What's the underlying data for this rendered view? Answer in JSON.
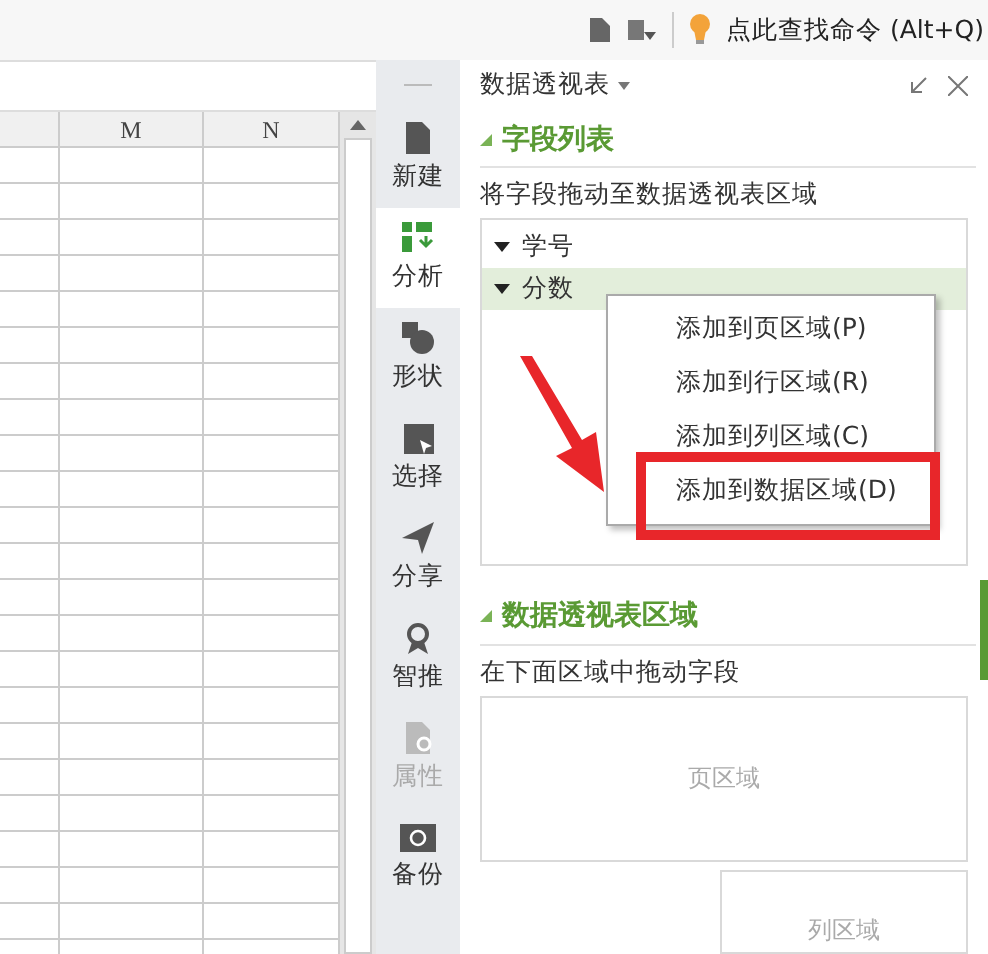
{
  "top_bar": {
    "search_hint": "点此查找命令 (Alt+Q)"
  },
  "spreadsheet": {
    "columns": [
      "M",
      "N"
    ]
  },
  "sidebar": {
    "items": [
      {
        "label": "新建",
        "selected": false,
        "disabled": false
      },
      {
        "label": "分析",
        "selected": true,
        "disabled": false
      },
      {
        "label": "形状",
        "selected": false,
        "disabled": false
      },
      {
        "label": "选择",
        "selected": false,
        "disabled": false
      },
      {
        "label": "分享",
        "selected": false,
        "disabled": false
      },
      {
        "label": "智推",
        "selected": false,
        "disabled": false
      },
      {
        "label": "属性",
        "selected": false,
        "disabled": true
      },
      {
        "label": "备份",
        "selected": false,
        "disabled": false
      }
    ]
  },
  "panel": {
    "title": "数据透视表",
    "field_section": {
      "heading": "字段列表",
      "hint": "将字段拖动至数据透视表区域",
      "fields": [
        {
          "label": "学号",
          "selected": false
        },
        {
          "label": "分数",
          "selected": true
        }
      ]
    },
    "context_menu": {
      "items": [
        {
          "label": "添加到页区域(P)",
          "marked": false
        },
        {
          "label": "添加到行区域(R)",
          "marked": false
        },
        {
          "label": "添加到列区域(C)",
          "marked": false
        },
        {
          "label": "添加到数据区域(D)",
          "marked": true
        }
      ]
    },
    "area_section": {
      "heading": "数据透视表区域",
      "hint": "在下面区域中拖动字段",
      "areas": [
        {
          "label": "页区域"
        },
        {
          "label": "列区域"
        }
      ]
    }
  }
}
